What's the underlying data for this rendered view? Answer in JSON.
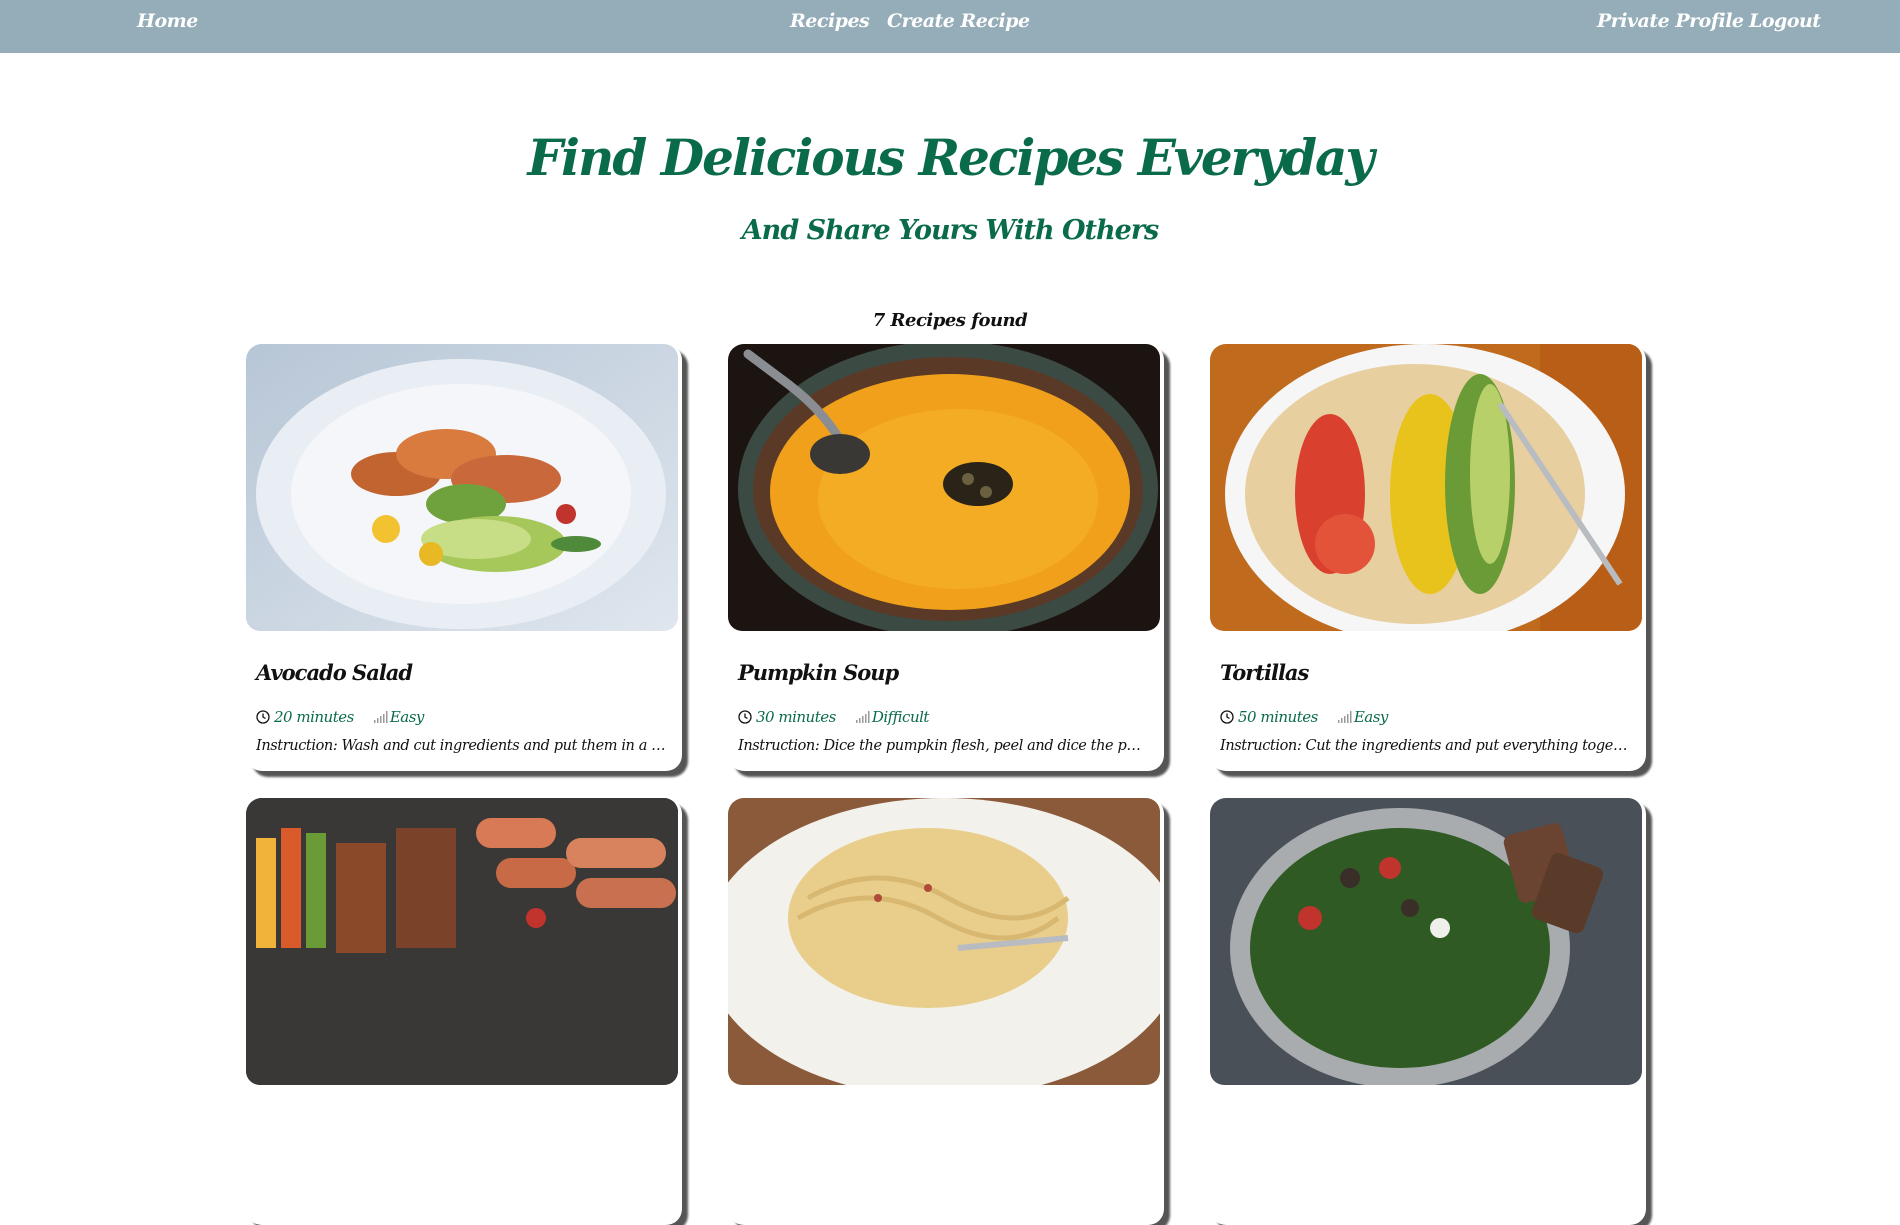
{
  "nav": {
    "home": "Home",
    "recipes": "Recipes",
    "create_recipe": "Create Recipe",
    "private_profile": "Private Profile",
    "logout": "Logout"
  },
  "hero": {
    "title": "Find Delicious Recipes Everyday",
    "subtitle": "And Share Yours With Others"
  },
  "results_count": "7 Recipes found",
  "colors": {
    "navbar": "#94adb8",
    "accent_green": "#0a6b4b"
  },
  "recipes": [
    {
      "title": "Avocado Salad",
      "time": "20 minutes",
      "difficulty": "Easy",
      "instruction": "Instruction: Wash and cut ingredients and put them in a bowl. Combine everything."
    },
    {
      "title": "Pumpkin Soup",
      "time": "30 minutes",
      "difficulty": "Difficult",
      "instruction": "Instruction: Dice the pumpkin flesh, peel and dice the potatoes. Wash and chop."
    },
    {
      "title": "Tortillas",
      "time": "50 minutes",
      "difficulty": "Easy",
      "instruction": "Instruction: Cut the ingredients and put everything together in the bread."
    },
    {
      "title": "",
      "time": "",
      "difficulty": "",
      "instruction": ""
    },
    {
      "title": "",
      "time": "",
      "difficulty": "",
      "instruction": ""
    },
    {
      "title": "",
      "time": "",
      "difficulty": "",
      "instruction": ""
    }
  ]
}
